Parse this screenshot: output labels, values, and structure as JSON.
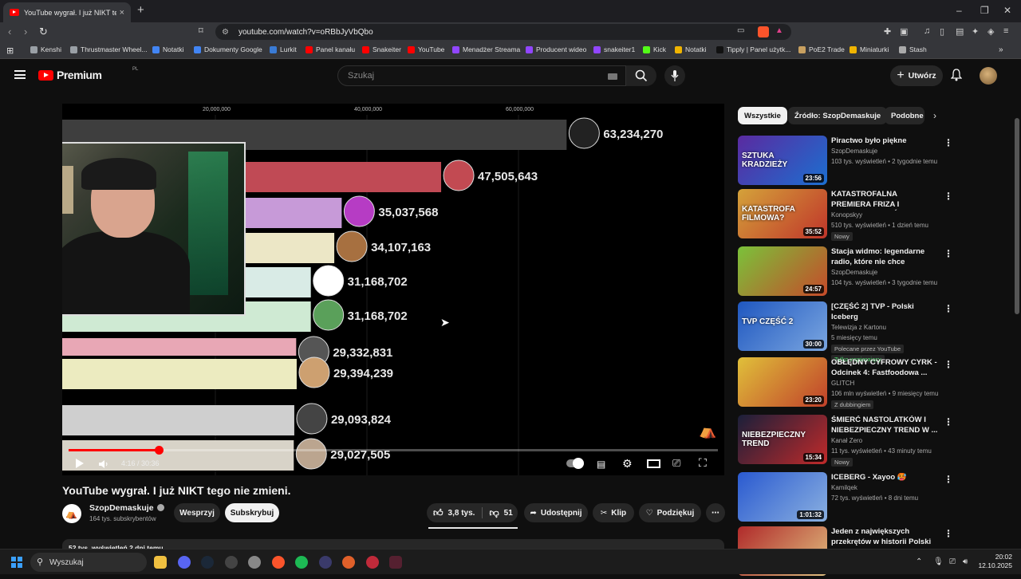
{
  "tab": {
    "title": "YouTube wygrał. I już NIKT tego",
    "close": "×",
    "new_tab": "+"
  },
  "window": {
    "minimize": "–",
    "maximize": "❐",
    "close": "✕"
  },
  "address": {
    "url": "youtube.com/watch?v=oRBbJyVbQbo"
  },
  "bookmarks": [
    {
      "label": "Kenshi",
      "color": "#9aa0a6"
    },
    {
      "label": "Thrustmaster Wheel...",
      "color": "#9aa0a6"
    },
    {
      "label": "Notatki",
      "color": "#4285f4"
    },
    {
      "label": "Dokumenty Google",
      "color": "#4285f4"
    },
    {
      "label": "Lurkit",
      "color": "#3a7bd5"
    },
    {
      "label": "Panel kanału",
      "color": "#ff0000"
    },
    {
      "label": "Snakeiter",
      "color": "#ff0000"
    },
    {
      "label": "YouTube",
      "color": "#ff0000"
    },
    {
      "label": "Menadżer Streama",
      "color": "#9146ff"
    },
    {
      "label": "Producent wideo",
      "color": "#9146ff"
    },
    {
      "label": "snakeiter1",
      "color": "#9146ff"
    },
    {
      "label": "Kick",
      "color": "#53fc18"
    },
    {
      "label": "Notatki",
      "color": "#f0b400"
    },
    {
      "label": "Tipply | Panel użytk...",
      "color": "#111111"
    },
    {
      "label": "PoE2 Trade",
      "color": "#c8a060"
    },
    {
      "label": "Miniaturki",
      "color": "#f0b400"
    },
    {
      "label": "Stash",
      "color": "#aaaaaa"
    }
  ],
  "masthead": {
    "brand": "Premium",
    "region": "PL",
    "search_placeholder": "Szukaj",
    "create_label": "Utwórz"
  },
  "chart_data": {
    "type": "bar",
    "x_ticks": [
      "20,000,000",
      "40,000,000",
      "60,000,000"
    ],
    "values": [
      63234270,
      47505643,
      35037568,
      34107163,
      31168702,
      31168702,
      29332831,
      29394239,
      29093824,
      29027505
    ],
    "labels": [
      "63,234,270",
      "47,505,643",
      "35,037,568",
      "34,107,163",
      "31,168,702",
      "31,168,702",
      "29,332,831",
      "29,394,239",
      "29,093,824",
      "29,027,505"
    ],
    "colors": [
      "#3e3e3e",
      "#c04a55",
      "#c79ad8",
      "#ece7c6",
      "#d9ebe6",
      "#cfead3",
      "#e8a7b5",
      "#ecebc0",
      "#cfcfcf",
      "#d8d3c8"
    ]
  },
  "player": {
    "time": "4:16 / 30:36",
    "progress": 0.139
  },
  "video": {
    "title": "YouTube wygrał. I już NIKT tego nie zmieni.",
    "channel": "SzopDemaskuje",
    "subs": "164 tys. subskrybentów",
    "support": "Wesprzyj",
    "subscribe": "Subskrybuj",
    "likes": "3,8 tys.",
    "dislikes": "51",
    "share": "Udostępnij",
    "clip": "Klip",
    "thanks": "Podziękuj",
    "desc": "52 tys. wyświetleń  2 dni temu"
  },
  "chips": [
    "Wszystkie",
    "Źródło: SzopDemaskuje",
    "Podobne"
  ],
  "recs": [
    {
      "title": "Piractwo było piękne",
      "channel": "SzopDemaskuje",
      "meta": "103 tys. wyświetleń • 2 tygodnie temu",
      "duration": "23:56",
      "colors": [
        "#5a2aa0",
        "#1c6fd0"
      ],
      "thumb_text": "SZTUKA KRADZIEŻY",
      "badges": []
    },
    {
      "title": "KATASTROFALNA PREMIERA FRIZA I WERSOW? (PORÓD N...",
      "channel": "Konopskyy",
      "meta": "510 tys. wyświetleń • 1 dzień temu",
      "duration": "35:52",
      "colors": [
        "#d4a23a",
        "#c0352a"
      ],
      "thumb_text": "KATASTROFA FILMOWA?",
      "badges": [
        "Nowy"
      ]
    },
    {
      "title": "Stacja widmo: legendarne radio, które nie chce zamilknąć",
      "channel": "SzopDemaskuje",
      "meta": "104 tys. wyświetleń • 3 tygodnie temu",
      "duration": "24:57",
      "colors": [
        "#7ac23a",
        "#c64a2a"
      ],
      "thumb_text": "",
      "badges": []
    },
    {
      "title": "[CZĘŚĆ 2] TVP - Polski Iceberg",
      "channel": "Telewizja z Kartonu",
      "meta": "5 miesięcy temu",
      "duration": "30:00",
      "colors": [
        "#1f57c0",
        "#7aa6e0"
      ],
      "thumb_text": "TVP  CZĘŚĆ 2",
      "badges": [
        "Polecane przez YouTube",
        "Tylko wspierający"
      ]
    },
    {
      "title": "OBŁĘDNY CYFROWY CYRK - Odcinek 4: Fastfoodowa ...",
      "channel": "GLITCH",
      "meta": "106 mln wyświetleń • 9 miesięcy temu",
      "duration": "23:20",
      "colors": [
        "#e0c03a",
        "#c0402a"
      ],
      "thumb_text": "",
      "badges": [
        "Z dubbingiem"
      ]
    },
    {
      "title": "ŚMIERĆ NASTOLATKÓW I NIEBEZPIECZNY TREND W ...",
      "channel": "Kanał Zero",
      "meta": "11 tys. wyświetleń • 43 minuty temu",
      "duration": "15:34",
      "colors": [
        "#1a1f3a",
        "#c02a2a"
      ],
      "thumb_text": "NIEBEZPIECZNY TREND",
      "badges": [
        "Nowy"
      ]
    },
    {
      "title": "ICEBERG - Xayoo 🥵",
      "channel": "Kamilqek",
      "meta": "72 tys. wyświetleń • 8 dni temu",
      "duration": "1:01:32",
      "colors": [
        "#2a5ad0",
        "#8ab0e0"
      ],
      "thumb_text": "",
      "badges": []
    },
    {
      "title": "Jeden z największych przekrętów w historii Polski",
      "channel": "",
      "meta": "",
      "duration": "",
      "colors": [
        "#b02a2a",
        "#e0c080"
      ],
      "thumb_text": "",
      "badges": []
    }
  ],
  "taskbar": {
    "search_placeholder": "Wyszukaj",
    "time": "20:02",
    "date": "12.10.2025",
    "apps": [
      {
        "name": "file-explorer-app",
        "color": "#f0c040"
      },
      {
        "name": "discord-app",
        "color": "#5865f2"
      },
      {
        "name": "steam-app",
        "color": "#1b2838"
      },
      {
        "name": "obs-app",
        "color": "#444"
      },
      {
        "name": "app-shield",
        "color": "#888"
      },
      {
        "name": "brave-app",
        "color": "#fb542b"
      },
      {
        "name": "spotify-app",
        "color": "#1db954"
      },
      {
        "name": "app-circle",
        "color": "#3a3a6a"
      },
      {
        "name": "app-orange",
        "color": "#e0602a"
      },
      {
        "name": "app-red",
        "color": "#c02a3a"
      },
      {
        "name": "app-dark",
        "color": "#552030"
      }
    ]
  }
}
